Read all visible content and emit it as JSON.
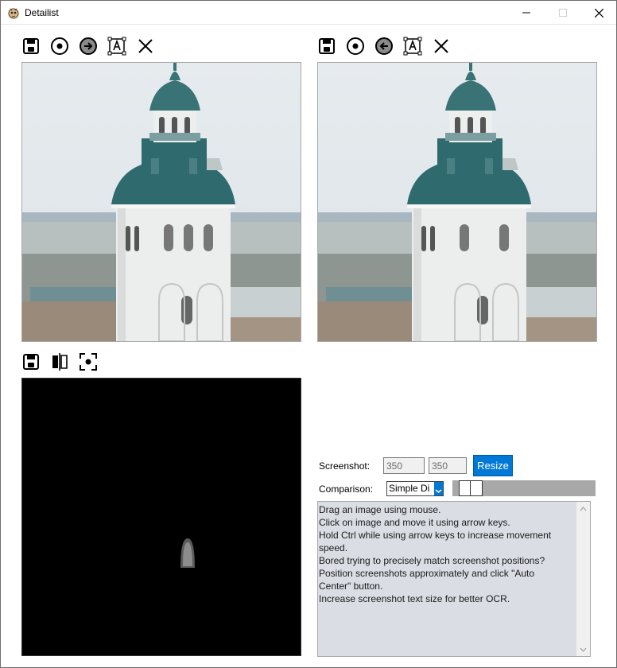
{
  "window": {
    "title": "Detailist",
    "controls": [
      "minimize-icon",
      "maximize-icon",
      "close-icon"
    ]
  },
  "left_toolbar": [
    "save-icon",
    "target-icon",
    "arrow-right-circle-icon",
    "ocr-text-icon",
    "close-icon"
  ],
  "right_toolbar": [
    "save-icon",
    "target-icon",
    "arrow-left-circle-icon",
    "ocr-text-icon",
    "close-icon"
  ],
  "diff_toolbar": [
    "save-icon",
    "compare-split-icon",
    "auto-center-icon"
  ],
  "screenshot": {
    "label": "Screenshot:",
    "width_value": "350",
    "height_value": "350",
    "resize_label": "Resize"
  },
  "comparison": {
    "label": "Comparison:",
    "selected": "Simple Di",
    "slider_value": 0.05
  },
  "help_lines": [
    "Drag an image using mouse.",
    "Click on image and move it using arrow keys.",
    "Hold Ctrl while using arrow keys to increase movement",
    "speed.",
    "Bored trying to precisely match screenshot positions?",
    "Position screenshots approximately and click \"Auto",
    "Center\" button.",
    "Increase screenshot text size for better OCR."
  ],
  "colors": {
    "accent": "#0078d7",
    "notes_bg": "#dadde3",
    "diff_bg": "#000000",
    "tower_roof": "#2f6b6e"
  }
}
